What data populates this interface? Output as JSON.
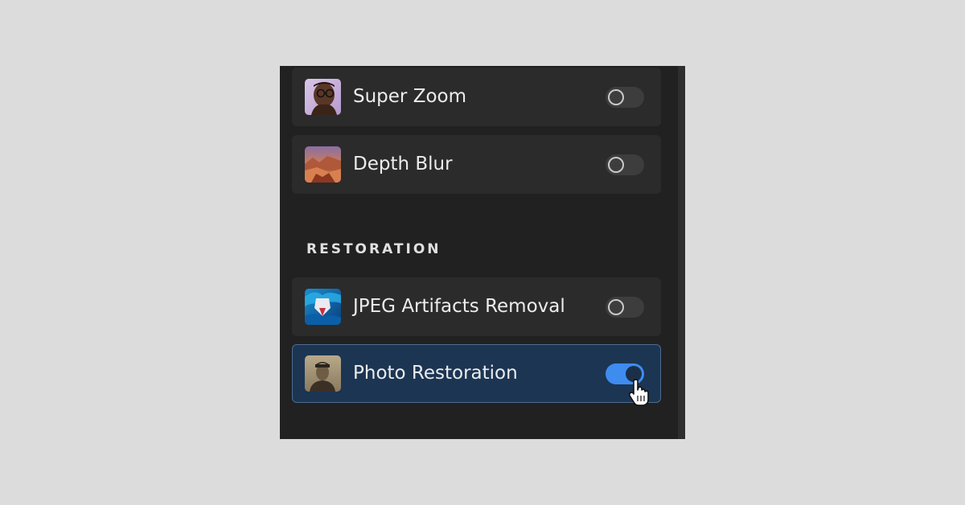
{
  "panel": {
    "filters": [
      {
        "label": "Super Zoom",
        "thumbnail_icon": "portrait-thumbnail",
        "enabled": false
      },
      {
        "label": "Depth Blur",
        "thumbnail_icon": "canyon-landscape-thumbnail",
        "enabled": false
      }
    ],
    "restoration": {
      "heading": "RESTORATION",
      "filters": [
        {
          "label": "JPEG Artifacts Removal",
          "thumbnail_icon": "abstract-blue-thumbnail",
          "enabled": false
        },
        {
          "label": "Photo Restoration",
          "thumbnail_icon": "vintage-portrait-thumbnail",
          "enabled": true
        }
      ]
    }
  },
  "colors": {
    "background": "#dcdcdc",
    "panel": "#212121",
    "row": "#2b2b2b",
    "active_row": "#1c3553",
    "toggle_on": "#3e8cf0"
  },
  "cursor_icon": "hand-pointer-icon"
}
